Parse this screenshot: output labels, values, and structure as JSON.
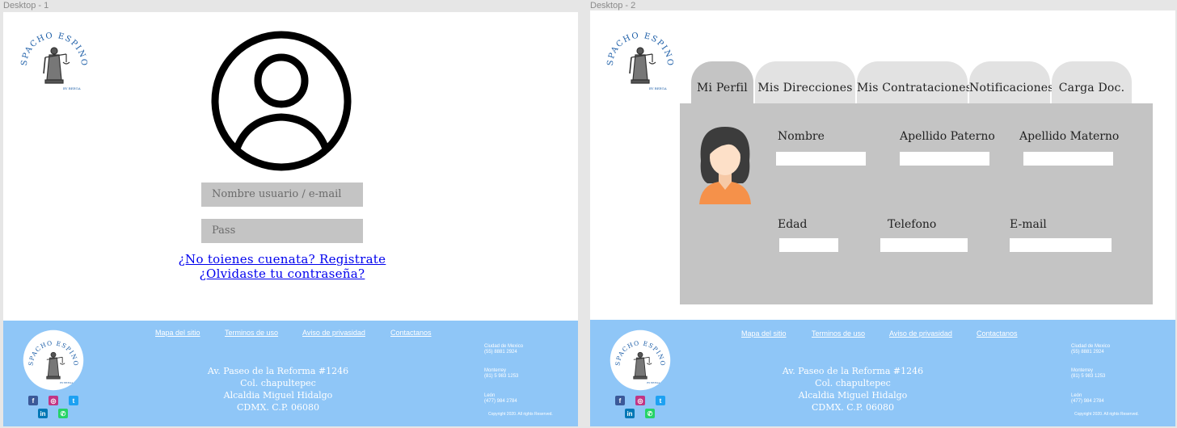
{
  "desktop1": {
    "label": "Desktop - 1",
    "login": {
      "username_placeholder": "Nombre usuario / e-mail",
      "password_placeholder": "Pass",
      "register_link": "¿No toienes cuenata? Registrate",
      "forgot_link": "¿Olvidaste tu contraseña?"
    }
  },
  "desktop2": {
    "label": "Desktop - 2",
    "tabs": [
      {
        "label": "Mi Perfil",
        "active": true
      },
      {
        "label": "Mis Direcciones",
        "active": false
      },
      {
        "label": "Mis Contrataciones",
        "active": false
      },
      {
        "label": "Notificaciones",
        "active": false
      },
      {
        "label": "Carga Doc.",
        "active": false
      }
    ],
    "profile": {
      "fields": {
        "nombre": "Nombre",
        "apellido_paterno": "Apellido Paterno",
        "apellido_materno": "Apellido Materno",
        "edad": "Edad",
        "telefono": "Telefono",
        "email": "E-mail"
      }
    }
  },
  "logo": {
    "arc_text": "DESPACHO ESPINOZA",
    "subtext": "BY BEEGA"
  },
  "footer": {
    "links": [
      "Mapa del sitio",
      "Terminos de uso",
      "Aviso de privasidad",
      "Contactanos"
    ],
    "address": [
      "Av. Paseo de la Reforma #1246",
      "Col. chapultepec",
      "Alcaldia Miguel Hidalgo",
      "CDMX. C.P. 06080"
    ],
    "branches": [
      {
        "city": "Ciudad de Mexico",
        "phone": "(55) 8881 2924"
      },
      {
        "city": "Monterrey",
        "phone": "(81) 5 983 1253"
      },
      {
        "city": "León",
        "phone": "(477) 984 2784"
      }
    ],
    "copyright": "Copyright 2020. All rights Reserved.",
    "social_icons": [
      "facebook-icon",
      "instagram-icon",
      "twitter-icon",
      "linkedin-icon",
      "whatsapp-icon"
    ]
  },
  "colors": {
    "footer_bg": "#8fc6f7",
    "input_gray": "#c4c4c4",
    "tab_inactive": "#e2e2e2",
    "link_blue": "#0000ee",
    "logo_blue": "#1e5fa8"
  }
}
